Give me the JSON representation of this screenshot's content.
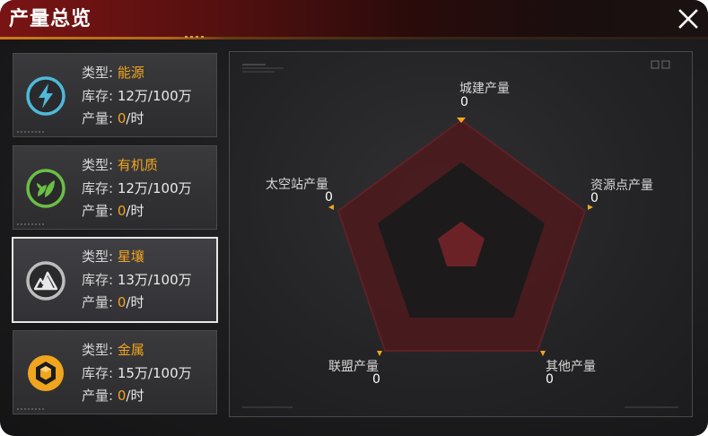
{
  "header": {
    "title": "产量总览"
  },
  "resources": [
    {
      "type_label": "类型:",
      "type_value": "能源",
      "stock_label": "库存:",
      "stock_value": "12万/100万",
      "output_label": "产量:",
      "output_value": "0",
      "output_unit": "/时",
      "icon": "lightning-icon",
      "accent": "#4fb9d9",
      "selected": false
    },
    {
      "type_label": "类型:",
      "type_value": "有机质",
      "stock_label": "库存:",
      "stock_value": "12万/100万",
      "output_label": "产量:",
      "output_value": "0",
      "output_unit": "/时",
      "icon": "leaf-icon",
      "accent": "#6cbe45",
      "selected": false
    },
    {
      "type_label": "类型:",
      "type_value": "星壤",
      "stock_label": "库存:",
      "stock_value": "13万/100万",
      "output_label": "产量:",
      "output_value": "0",
      "output_unit": "/时",
      "icon": "mountain-icon",
      "accent": "#bdbdbd",
      "selected": true
    },
    {
      "type_label": "类型:",
      "type_value": "金属",
      "stock_label": "库存:",
      "stock_value": "15万/100万",
      "output_label": "产量:",
      "output_value": "0",
      "output_unit": "/时",
      "icon": "hexagon-cube-icon",
      "accent": "#f0a51e",
      "selected": false
    }
  ],
  "radar": {
    "axes": [
      {
        "label": "城建产量",
        "value": "0"
      },
      {
        "label": "资源点产量",
        "value": "0"
      },
      {
        "label": "其他产量",
        "value": "0"
      },
      {
        "label": "联盟产量",
        "value": "0"
      },
      {
        "label": "太空站产量",
        "value": "0"
      }
    ]
  },
  "colors": {
    "highlight": "#f0a51e",
    "radar_outer": "#5a1a1e",
    "radar_inner": "#7a2226"
  }
}
